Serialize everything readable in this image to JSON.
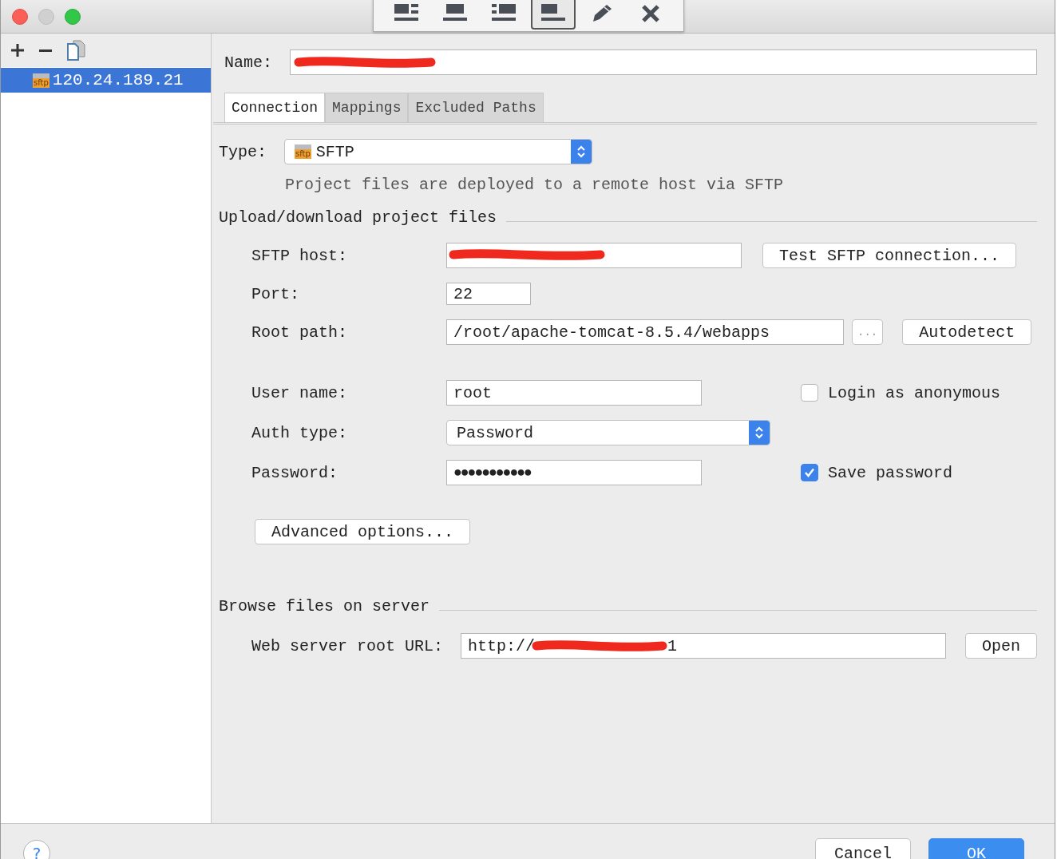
{
  "toolbar": {
    "buttons": [
      {
        "kind": "split-right",
        "selected": false
      },
      {
        "kind": "bottom",
        "selected": false
      },
      {
        "kind": "split-left",
        "selected": false
      },
      {
        "kind": "bottom-bar",
        "selected": true
      },
      {
        "kind": "pencil",
        "selected": false
      },
      {
        "kind": "close",
        "selected": false
      }
    ]
  },
  "sidebar": {
    "items": [
      {
        "icon_text": "sftp",
        "label": "120.24.189.21",
        "selected": true
      }
    ]
  },
  "name_field": {
    "label": "Name:",
    "redacted": true
  },
  "tabs": [
    {
      "label": "Connection",
      "selected": true
    },
    {
      "label": "Mappings",
      "selected": false
    },
    {
      "label": "Excluded Paths",
      "selected": false
    }
  ],
  "type": {
    "label": "Type:",
    "icon_text": "sftp",
    "value": "SFTP",
    "description": "Project files are deployed to a remote host via SFTP"
  },
  "upload_section": "Upload/download project files",
  "host": {
    "label": "SFTP host:",
    "redacted": true,
    "button": "Test SFTP connection..."
  },
  "port": {
    "label": "Port:",
    "value": "22"
  },
  "root_path": {
    "label": "Root path:",
    "value": "/root/apache-tomcat-8.5.4/webapps",
    "browse": "...",
    "button": "Autodetect"
  },
  "user_name": {
    "label": "User name:",
    "value": "root"
  },
  "login_anonymous": {
    "label": "Login as anonymous",
    "checked": false
  },
  "auth_type": {
    "label": "Auth type:",
    "value": "Password"
  },
  "password": {
    "label": "Password:",
    "value": "●●●●●●●●●●●"
  },
  "save_password": {
    "label": "Save password",
    "checked": true
  },
  "advanced_button": "Advanced options...",
  "browse_section": "Browse files on server",
  "web_url": {
    "label": "Web server root URL:",
    "value": "http://",
    "redacted": true,
    "tail": "1",
    "button": "Open"
  },
  "footer": {
    "help": "?",
    "buttons": [
      {
        "label": "Cancel",
        "kind": "default"
      },
      {
        "label": "OK",
        "kind": "primary"
      }
    ]
  }
}
